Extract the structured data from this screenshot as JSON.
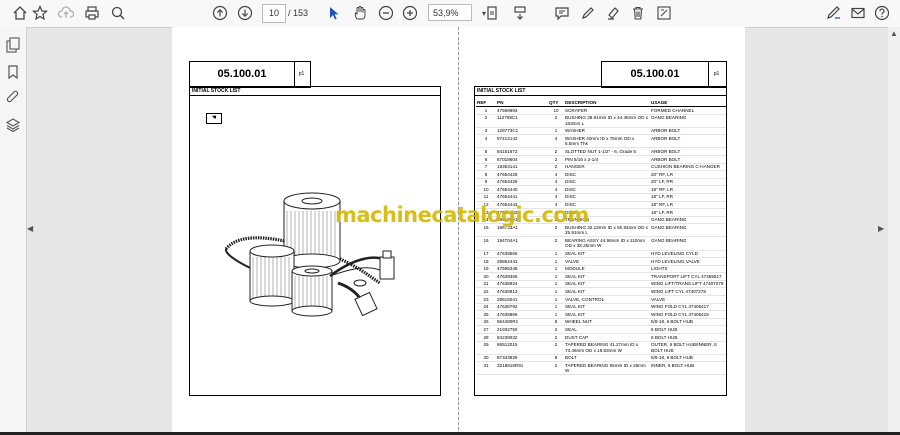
{
  "toolbar": {
    "current_page": "10",
    "total_pages": "/ 153",
    "zoom": "53,9%"
  },
  "left_page": {
    "header_code": "05.100.01",
    "header_page": "p1",
    "section_title": "INITIAL STOCK LIST"
  },
  "right_page": {
    "header_code": "05.100.01",
    "header_page": "p1",
    "section_title": "INITIAL STOCK LIST",
    "columns": [
      "REF",
      "PN",
      "QTY",
      "DESCRIPTION",
      "USAGE"
    ],
    "rows": [
      [
        "1",
        "47569693",
        "10",
        "SCRAPER",
        "FORMED CHANNEL"
      ],
      [
        "2",
        "112769C1",
        "2",
        "BUSHING 38.91mm ID x 44.45mm OD x 163mm L",
        "GANG BEARING"
      ],
      [
        "3",
        "128773C1",
        "1",
        "WASHER",
        "ARBOR BOLT"
      ],
      [
        "4",
        "87412142",
        "4",
        "WASHER 40mm ID x 75mm OD x 6.5mm Thk",
        "ARBOR BOLT"
      ],
      [
        "5",
        "84151672",
        "2",
        "SLOTTED NUT 1-1/2\" - 6, Grade 5",
        "ARBOR BOLT"
      ],
      [
        "6",
        "87018604",
        "2",
        "PIN 5/16 x 2-1/4",
        "ARBOR BOLT"
      ],
      [
        "7",
        "19363141",
        "2",
        "HANGER",
        "CUSHION BEARING C-HANGER"
      ],
      [
        "8",
        "47654428",
        "4",
        "DISC",
        "20\" RF, LR"
      ],
      [
        "9",
        "47654429",
        "4",
        "DISC",
        "20\" LF, RR"
      ],
      [
        "10",
        "47654440",
        "4",
        "DISC",
        "18\" RF, LR"
      ],
      [
        "11",
        "47654441",
        "4",
        "DISC",
        "18\" LF, RR"
      ],
      [
        "12",
        "47654443",
        "4",
        "DISC",
        "18\" RF, LR"
      ],
      [
        "13",
        "47654442",
        "4",
        "DISC",
        "18\" LF, RR"
      ],
      [
        "14",
        "196102A1",
        "2",
        "TRUNNION",
        "GANG BEARING"
      ],
      [
        "15",
        "196733A1",
        "2",
        "BUSHING 32.13mm ID x 50.83mm OD x 25.91mm L",
        "GANG BEARING"
      ],
      [
        "16",
        "194704A1",
        "2",
        "BEARING ASSY 44.96mm ID x 110mm OD x 38.25mm W",
        "GANG BEARING"
      ],
      [
        "17",
        "47639565",
        "1",
        "SEAL KIT",
        "HYD LEVELING CYLD"
      ],
      [
        "18",
        "29862441",
        "1",
        "VALVE",
        "HYD LEVELING VALVE"
      ],
      [
        "19",
        "47595348",
        "1",
        "MODULE",
        "LIGHTS"
      ],
      [
        "20",
        "47639366",
        "1",
        "SEAL KIT",
        "TRANSPORT LIFT CYL 47465517"
      ],
      [
        "21",
        "47638924",
        "1",
        "SEAL KIT",
        "WING LIFT/TRANS LIFT 47407279"
      ],
      [
        "22",
        "47638913",
        "1",
        "SEAL KIT",
        "WING LIFT CYL 47407278"
      ],
      [
        "23",
        "29615041",
        "1",
        "VALVE, CONTROL",
        "VALVE"
      ],
      [
        "24",
        "47638792",
        "1",
        "SEAL KIT",
        "WING FOLD CYL 47406417"
      ],
      [
        "25",
        "47638866",
        "1",
        "SEAL KIT",
        "WING FOLD CYL 47406415"
      ],
      [
        "26",
        "564480R1",
        "8",
        "WHEEL NUT",
        "5/8-18, 6 BOLT HUB"
      ],
      [
        "27",
        "21932750",
        "2",
        "SEAL",
        "6 BOLT HUB"
      ],
      [
        "28",
        "84238032",
        "2",
        "DUST CAP",
        "6 BOLT HUB"
      ],
      [
        "29",
        "86512015",
        "2",
        "TAPERED BEARING 41.27mm ID x 73.46mm OD x 19.63mm W",
        "OUTER, 6 BOLT HUB/INNER, 6 BOLT HUB"
      ],
      [
        "30",
        "87343929",
        "8",
        "BOLT",
        "5/8-18, 6 BOLT HUB"
      ],
      [
        "31",
        "3218616R91",
        "2",
        "TAPERED BEARING 55mm ID x 26mm W",
        "INNER, 6 BOLT HUB"
      ]
    ]
  },
  "watermark": "machinecatalogic.com"
}
